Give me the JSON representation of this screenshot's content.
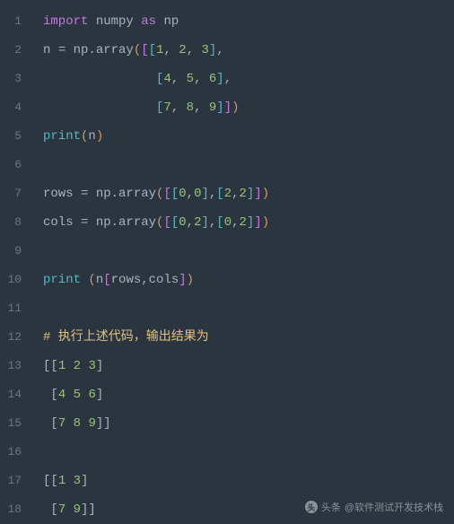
{
  "lines": [
    {
      "num": "1",
      "tokens": [
        {
          "t": "import",
          "c": "kw"
        },
        {
          "t": " ",
          "c": ""
        },
        {
          "t": "numpy",
          "c": "mod"
        },
        {
          "t": " ",
          "c": ""
        },
        {
          "t": "as",
          "c": "kw"
        },
        {
          "t": " ",
          "c": ""
        },
        {
          "t": "np",
          "c": "mod"
        }
      ]
    },
    {
      "num": "2",
      "tokens": [
        {
          "t": "n ",
          "c": "id"
        },
        {
          "t": "=",
          "c": "punct"
        },
        {
          "t": " np.array",
          "c": "fn"
        },
        {
          "t": "(",
          "c": "bracket1"
        },
        {
          "t": "[",
          "c": "bracket2"
        },
        {
          "t": "[",
          "c": "bracket3"
        },
        {
          "t": "1",
          "c": "num"
        },
        {
          "t": ", ",
          "c": "punct"
        },
        {
          "t": "2",
          "c": "num"
        },
        {
          "t": ", ",
          "c": "punct"
        },
        {
          "t": "3",
          "c": "num"
        },
        {
          "t": "]",
          "c": "bracket3"
        },
        {
          "t": ",",
          "c": "punct"
        }
      ]
    },
    {
      "num": "3",
      "tokens": [
        {
          "t": "               ",
          "c": ""
        },
        {
          "t": "[",
          "c": "bracket3"
        },
        {
          "t": "4",
          "c": "num"
        },
        {
          "t": ", ",
          "c": "punct"
        },
        {
          "t": "5",
          "c": "num"
        },
        {
          "t": ", ",
          "c": "punct"
        },
        {
          "t": "6",
          "c": "num"
        },
        {
          "t": "]",
          "c": "bracket3"
        },
        {
          "t": ",",
          "c": "punct"
        }
      ]
    },
    {
      "num": "4",
      "tokens": [
        {
          "t": "               ",
          "c": ""
        },
        {
          "t": "[",
          "c": "bracket3"
        },
        {
          "t": "7",
          "c": "num"
        },
        {
          "t": ", ",
          "c": "punct"
        },
        {
          "t": "8",
          "c": "num"
        },
        {
          "t": ", ",
          "c": "punct"
        },
        {
          "t": "9",
          "c": "num"
        },
        {
          "t": "]",
          "c": "bracket3"
        },
        {
          "t": "]",
          "c": "bracket2"
        },
        {
          "t": ")",
          "c": "bracket1"
        }
      ]
    },
    {
      "num": "5",
      "tokens": [
        {
          "t": "print",
          "c": "builtin"
        },
        {
          "t": "(",
          "c": "bracket1"
        },
        {
          "t": "n",
          "c": "id"
        },
        {
          "t": ")",
          "c": "bracket1"
        }
      ]
    },
    {
      "num": "6",
      "tokens": []
    },
    {
      "num": "7",
      "tokens": [
        {
          "t": "rows ",
          "c": "id"
        },
        {
          "t": "=",
          "c": "punct"
        },
        {
          "t": " np.array",
          "c": "fn"
        },
        {
          "t": "(",
          "c": "bracket1"
        },
        {
          "t": "[",
          "c": "bracket2"
        },
        {
          "t": "[",
          "c": "bracket3"
        },
        {
          "t": "0",
          "c": "num"
        },
        {
          "t": ",",
          "c": "punct"
        },
        {
          "t": "0",
          "c": "num"
        },
        {
          "t": "]",
          "c": "bracket3"
        },
        {
          "t": ",",
          "c": "punct"
        },
        {
          "t": "[",
          "c": "bracket3"
        },
        {
          "t": "2",
          "c": "num"
        },
        {
          "t": ",",
          "c": "punct"
        },
        {
          "t": "2",
          "c": "num"
        },
        {
          "t": "]",
          "c": "bracket3"
        },
        {
          "t": "]",
          "c": "bracket2"
        },
        {
          "t": ")",
          "c": "bracket1"
        }
      ]
    },
    {
      "num": "8",
      "tokens": [
        {
          "t": "cols ",
          "c": "id"
        },
        {
          "t": "=",
          "c": "punct"
        },
        {
          "t": " np.array",
          "c": "fn"
        },
        {
          "t": "(",
          "c": "bracket1"
        },
        {
          "t": "[",
          "c": "bracket2"
        },
        {
          "t": "[",
          "c": "bracket3"
        },
        {
          "t": "0",
          "c": "num"
        },
        {
          "t": ",",
          "c": "punct"
        },
        {
          "t": "2",
          "c": "num"
        },
        {
          "t": "]",
          "c": "bracket3"
        },
        {
          "t": ",",
          "c": "punct"
        },
        {
          "t": "[",
          "c": "bracket3"
        },
        {
          "t": "0",
          "c": "num"
        },
        {
          "t": ",",
          "c": "punct"
        },
        {
          "t": "2",
          "c": "num"
        },
        {
          "t": "]",
          "c": "bracket3"
        },
        {
          "t": "]",
          "c": "bracket2"
        },
        {
          "t": ")",
          "c": "bracket1"
        }
      ]
    },
    {
      "num": "9",
      "tokens": []
    },
    {
      "num": "10",
      "tokens": [
        {
          "t": "print",
          "c": "builtin"
        },
        {
          "t": " ",
          "c": ""
        },
        {
          "t": "(",
          "c": "bracket1"
        },
        {
          "t": "n",
          "c": "id"
        },
        {
          "t": "[",
          "c": "bracket2"
        },
        {
          "t": "rows,cols",
          "c": "id"
        },
        {
          "t": "]",
          "c": "bracket2"
        },
        {
          "t": ")",
          "c": "bracket1"
        }
      ]
    },
    {
      "num": "11",
      "tokens": []
    },
    {
      "num": "12",
      "tokens": [
        {
          "t": "# 执行上述代码，输出结果为",
          "c": "comment"
        }
      ]
    },
    {
      "num": "13",
      "tokens": [
        {
          "t": "[[",
          "c": "punct"
        },
        {
          "t": "1",
          "c": "num"
        },
        {
          "t": " ",
          "c": ""
        },
        {
          "t": "2",
          "c": "num"
        },
        {
          "t": " ",
          "c": ""
        },
        {
          "t": "3",
          "c": "num"
        },
        {
          "t": "]",
          "c": "punct"
        }
      ]
    },
    {
      "num": "14",
      "tokens": [
        {
          "t": " ",
          "c": ""
        },
        {
          "t": "[",
          "c": "punct"
        },
        {
          "t": "4",
          "c": "num"
        },
        {
          "t": " ",
          "c": ""
        },
        {
          "t": "5",
          "c": "num"
        },
        {
          "t": " ",
          "c": ""
        },
        {
          "t": "6",
          "c": "num"
        },
        {
          "t": "]",
          "c": "punct"
        }
      ]
    },
    {
      "num": "15",
      "tokens": [
        {
          "t": " ",
          "c": ""
        },
        {
          "t": "[",
          "c": "punct"
        },
        {
          "t": "7",
          "c": "num"
        },
        {
          "t": " ",
          "c": ""
        },
        {
          "t": "8",
          "c": "num"
        },
        {
          "t": " ",
          "c": ""
        },
        {
          "t": "9",
          "c": "num"
        },
        {
          "t": "]]",
          "c": "punct"
        }
      ]
    },
    {
      "num": "16",
      "tokens": []
    },
    {
      "num": "17",
      "tokens": [
        {
          "t": "[[",
          "c": "punct"
        },
        {
          "t": "1",
          "c": "num"
        },
        {
          "t": " ",
          "c": ""
        },
        {
          "t": "3",
          "c": "num"
        },
        {
          "t": "]",
          "c": "punct"
        }
      ]
    },
    {
      "num": "18",
      "tokens": [
        {
          "t": " ",
          "c": ""
        },
        {
          "t": "[",
          "c": "punct"
        },
        {
          "t": "7",
          "c": "num"
        },
        {
          "t": " ",
          "c": ""
        },
        {
          "t": "9",
          "c": "num"
        },
        {
          "t": "]]",
          "c": "punct"
        }
      ]
    }
  ],
  "watermark": {
    "prefix": "头条",
    "text": "@软件测试开发技术栈"
  }
}
